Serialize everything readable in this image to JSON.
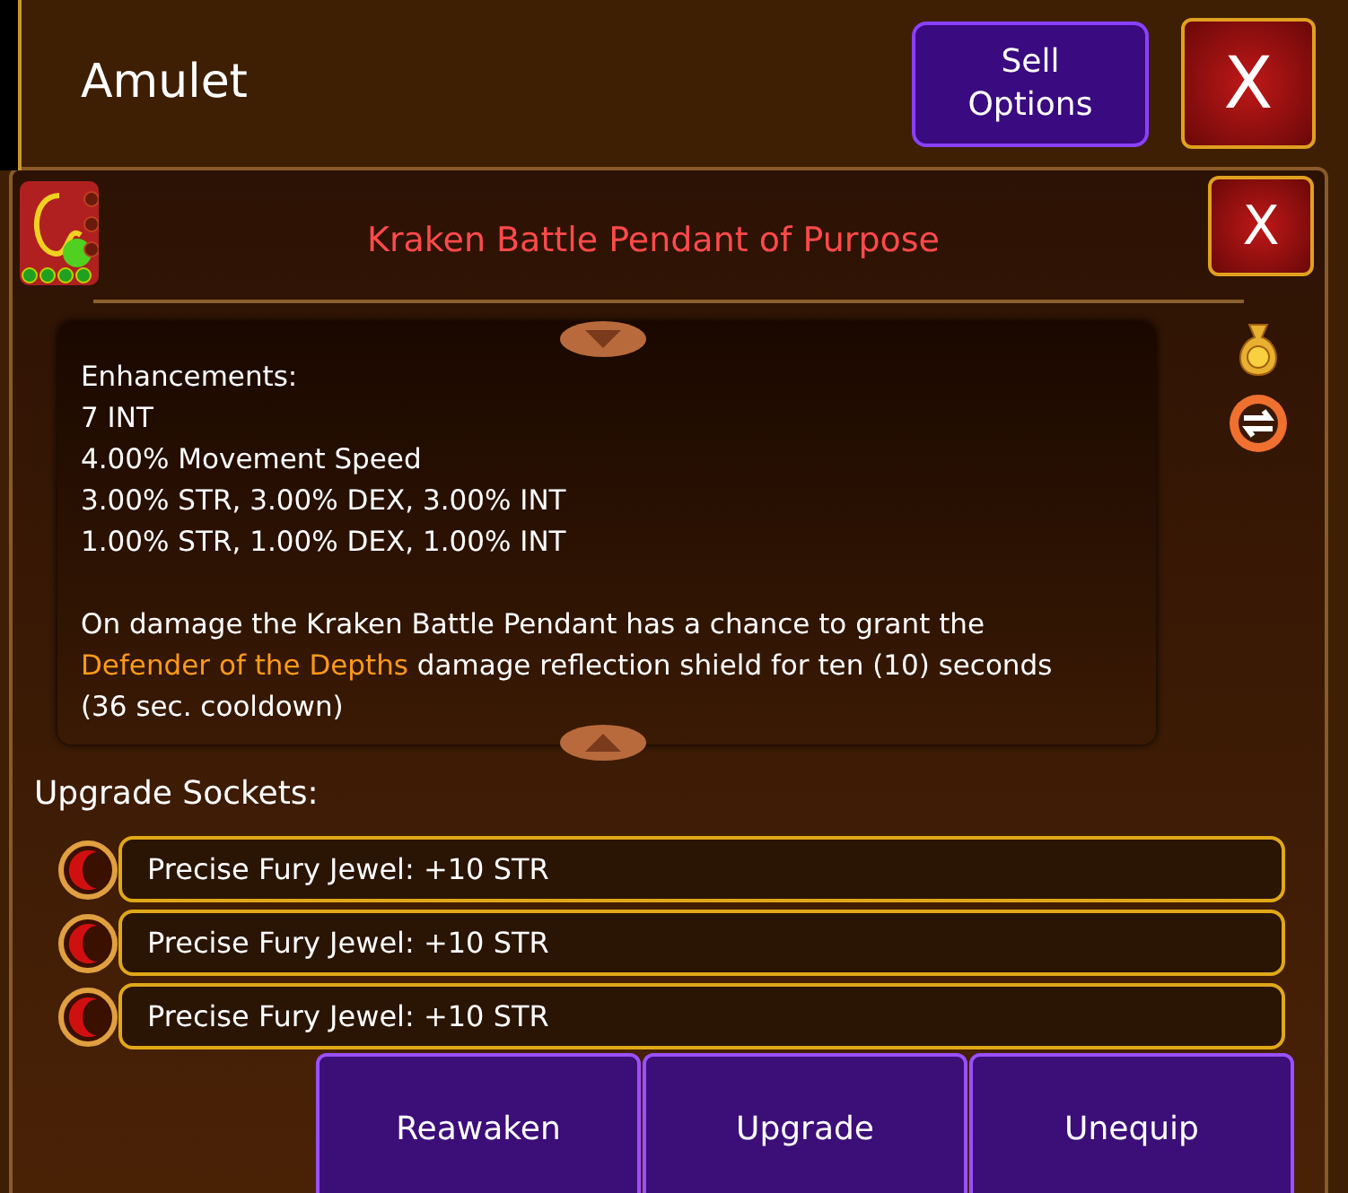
{
  "header": {
    "title": "Amulet",
    "sell_button": "Sell Options",
    "close_button": "X"
  },
  "item": {
    "name": "Kraken Battle Pendant of Purpose",
    "close_button": "X",
    "gem_slots": [
      {
        "filled": true
      },
      {
        "filled": true
      },
      {
        "filled": true
      },
      {
        "filled": true
      }
    ]
  },
  "details": {
    "lines": [
      "Enhancements:",
      "7 INT",
      "4.00% Movement Speed",
      "3.00% STR, 3.00% DEX, 3.00% INT",
      "1.00% STR, 1.00% DEX, 1.00% INT"
    ],
    "description": [
      {
        "kind": "plain",
        "text": "On damage the Kraken Battle Pendant has a chance to grant the "
      },
      {
        "kind": "highlight",
        "text": "Defender of the Depths"
      },
      {
        "kind": "plain",
        "text": " damage reflection shield for ten (10) seconds (36 sec. cooldown)"
      }
    ]
  },
  "sockets": {
    "label": "Upgrade Sockets:",
    "items": [
      {
        "text": "Precise Fury Jewel: +10 STR"
      },
      {
        "text": "Precise Fury Jewel: +10 STR"
      },
      {
        "text": "Precise Fury Jewel: +10 STR"
      }
    ]
  },
  "actions": [
    "Reawaken",
    "Upgrade",
    "Unequip"
  ]
}
